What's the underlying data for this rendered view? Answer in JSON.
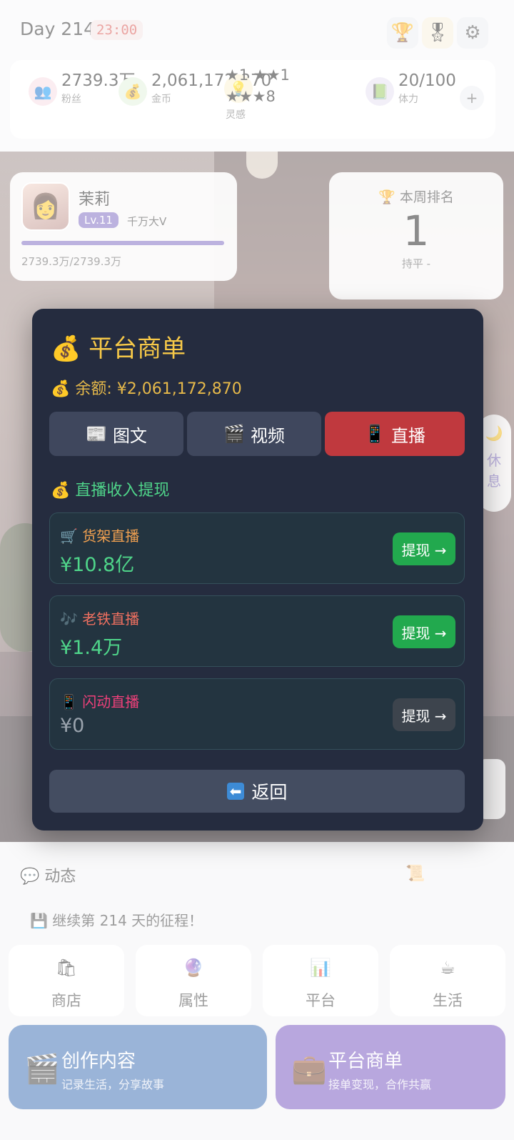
{
  "header": {
    "day": "Day 214",
    "clock": "23:00",
    "icons": [
      "trophy-icon",
      "medal-icon",
      "gear-icon"
    ]
  },
  "stats": {
    "fans": {
      "value": "2739.3万",
      "label": "粉丝",
      "icon": "👥"
    },
    "coins": {
      "value": "2,061,172,870",
      "label": "金币",
      "icon": "💰"
    },
    "inspiration": {
      "line1": "★1 ★★1",
      "line2": "★★★8",
      "label": "灵感",
      "icon": "💡"
    },
    "stamina": {
      "value": "20/100",
      "label": "体力",
      "icon": "📗"
    }
  },
  "player": {
    "name": "茉莉",
    "level": "Lv.11",
    "title": "千万大V",
    "exp": "2739.3万/2739.3万",
    "progress": 1.0
  },
  "rank": {
    "title": "本周排名",
    "icon": "🏆",
    "value": "1",
    "change": "持平 -"
  },
  "rest": {
    "label1": "休",
    "label2": "息",
    "icon": "🌙"
  },
  "modal": {
    "title": "平台商单",
    "title_icon": "💰",
    "balance_icon": "💰",
    "balance": "余额: ¥2,061,172,870",
    "tabs": [
      {
        "icon": "📰",
        "label": "图文"
      },
      {
        "icon": "🎬",
        "label": "视频"
      },
      {
        "icon": "📱",
        "label": "直播"
      }
    ],
    "section_icon": "💰",
    "section_title": "直播收入提现",
    "items": [
      {
        "icon": "🛒",
        "name": "货架直播",
        "amount": "¥10.8亿",
        "button": "提现 →",
        "name_color": "#f0a050"
      },
      {
        "icon": "🎶",
        "name": "老铁直播",
        "amount": "¥1.4万",
        "button": "提现 →",
        "name_color": "#f07060"
      },
      {
        "icon": "📱",
        "name": "闪动直播",
        "amount": "¥0",
        "button": "提现 →",
        "name_color": "#f0407a"
      }
    ],
    "back_icon": "⬅",
    "back_label": "返回"
  },
  "feed": {
    "title": "动态",
    "title_icon": "💬",
    "scroll_icon": "📜",
    "text": "💾 继续第 214 天的征程！"
  },
  "grid": [
    {
      "icon": "🛍",
      "label": "商店"
    },
    {
      "icon": "🔮",
      "label": "属性"
    },
    {
      "icon": "📊",
      "label": "平台"
    },
    {
      "icon": "☕",
      "label": "生活"
    }
  ],
  "actions": {
    "create": {
      "icon": "🎬",
      "title": "创作内容",
      "subtitle": "记录生活，分享故事"
    },
    "orders": {
      "icon": "💼",
      "title": "平台商单",
      "subtitle": "接单变现，合作共赢"
    }
  }
}
